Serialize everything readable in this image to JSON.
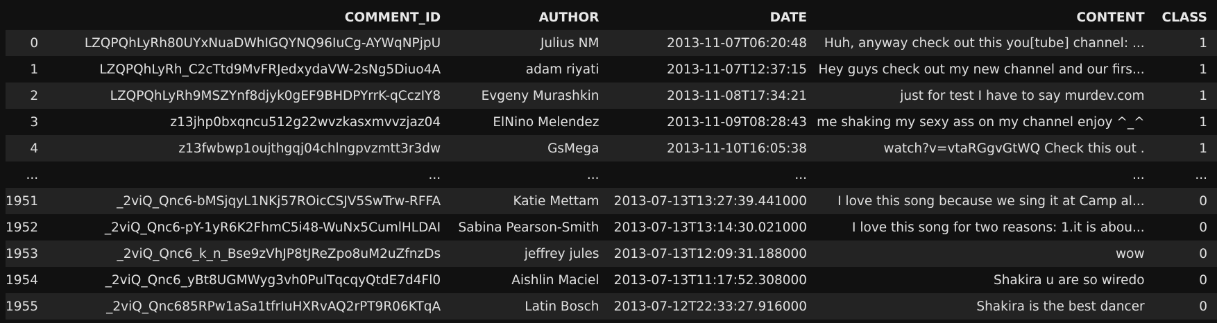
{
  "table": {
    "columns": [
      "",
      "COMMENT_ID",
      "AUTHOR",
      "DATE",
      "CONTENT",
      "CLASS"
    ],
    "rows": [
      [
        "0",
        "LZQPQhLyRh80UYxNuaDWhIGQYNQ96IuCg-AYWqNPjpU",
        "Julius NM",
        "2013-11-07T06:20:48",
        "Huh, anyway check out this you[tube] channel: ...",
        "1"
      ],
      [
        "1",
        "LZQPQhLyRh_C2cTtd9MvFRJedxydaVW-2sNg5Diuo4A",
        "adam riyati",
        "2013-11-07T12:37:15",
        "Hey guys check out my new channel and our firs...",
        "1"
      ],
      [
        "2",
        "LZQPQhLyRh9MSZYnf8djyk0gEF9BHDPYrrK-qCczIY8",
        "Evgeny Murashkin",
        "2013-11-08T17:34:21",
        "just for test I have to say murdev.com",
        "1"
      ],
      [
        "3",
        "z13jhp0bxqncu512g22wvzkasxmvvzjaz04",
        "ElNino Melendez",
        "2013-11-09T08:28:43",
        "me shaking my sexy ass on my channel enjoy ^_^",
        "1"
      ],
      [
        "4",
        "z13fwbwp1oujthgqj04chlngpvzmtt3r3dw",
        "GsMega",
        "2013-11-10T16:05:38",
        "watch?v=vtaRGgvGtWQ Check this out .",
        "1"
      ],
      [
        "...",
        "...",
        "...",
        "...",
        "...",
        "..."
      ],
      [
        "1951",
        "_2viQ_Qnc6-bMSjqyL1NKj57ROicCSJV5SwTrw-RFFA",
        "Katie Mettam",
        "2013-07-13T13:27:39.441000",
        "I love this song because we sing it at Camp al...",
        "0"
      ],
      [
        "1952",
        "_2viQ_Qnc6-pY-1yR6K2FhmC5i48-WuNx5CumlHLDAI",
        "Sabina Pearson-Smith",
        "2013-07-13T13:14:30.021000",
        "I love this song for two reasons: 1.it is abou...",
        "0"
      ],
      [
        "1953",
        "_2viQ_Qnc6_k_n_Bse9zVhJP8tJReZpo8uM2uZfnzDs",
        "jeffrey jules",
        "2013-07-13T12:09:31.188000",
        "wow",
        "0"
      ],
      [
        "1954",
        "_2viQ_Qnc6_yBt8UGMWyg3vh0PulTqcqyQtdE7d4Fl0",
        "Aishlin Maciel",
        "2013-07-13T11:17:52.308000",
        "Shakira u are so wiredo",
        "0"
      ],
      [
        "1955",
        "_2viQ_Qnc685RPw1aSa1tfrIuHXRvAQ2rPT9R06KTqA",
        "Latin Bosch",
        "2013-07-12T22:33:27.916000",
        "Shakira is the best dancer",
        "0"
      ]
    ]
  }
}
